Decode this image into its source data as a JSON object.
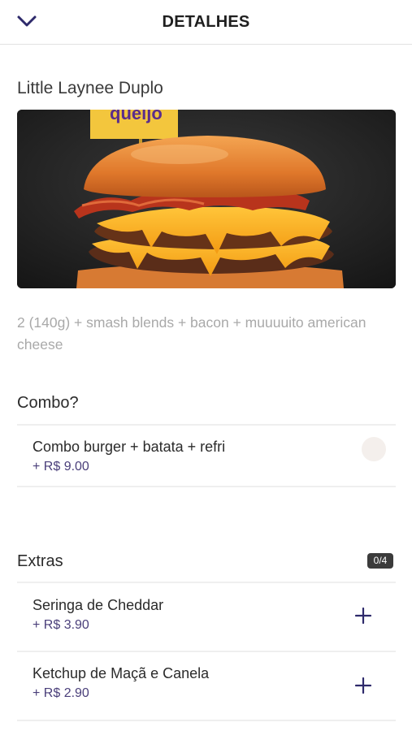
{
  "header": {
    "title": "DETALHES",
    "back_icon": "chevron-down-icon"
  },
  "product": {
    "name": "Little Laynee Duplo",
    "image_label": "queijo",
    "description": "2 (140g) + smash blends + bacon + muuuuito american cheese"
  },
  "combo_section": {
    "title": "Combo?",
    "options": [
      {
        "name": "Combo burger + batata + refri",
        "price": "+ R$ 9.00"
      }
    ]
  },
  "extras_section": {
    "title": "Extras",
    "counter": "0/4",
    "options": [
      {
        "name": "Seringa de Cheddar",
        "price": "+ R$ 3.90"
      },
      {
        "name": "Ketchup de Maçã e Canela",
        "price": "+ R$ 2.90"
      }
    ]
  },
  "colors": {
    "accent": "#2e2a6b",
    "price": "#4a3f7a",
    "badge_bg": "#3b3b3b"
  }
}
